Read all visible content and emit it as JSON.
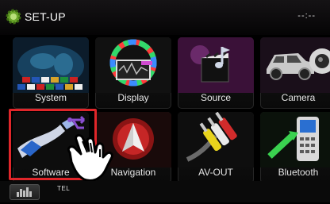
{
  "header": {
    "title": "SET-UP",
    "time": "--:--",
    "icon": "gear-icon"
  },
  "tiles": [
    {
      "label": "System",
      "icon": "world-map-flags-icon"
    },
    {
      "label": "Display",
      "icon": "display-color-wheel-icon"
    },
    {
      "label": "Source",
      "icon": "clapperboard-music-icon"
    },
    {
      "label": "Camera",
      "icon": "car-camera-icon"
    },
    {
      "label": "Software",
      "icon": "usb-stick-icon"
    },
    {
      "label": "Navigation",
      "icon": "navigation-arrow-icon"
    },
    {
      "label": "AV-OUT",
      "icon": "av-cable-icon"
    },
    {
      "label": "Bluetooth",
      "icon": "bluetooth-phone-icon"
    }
  ],
  "footer": {
    "tel_label": "TEL",
    "eq_icon": "equalizer-icon"
  },
  "colors": {
    "highlight": "#e0262a",
    "background": "#000000"
  }
}
